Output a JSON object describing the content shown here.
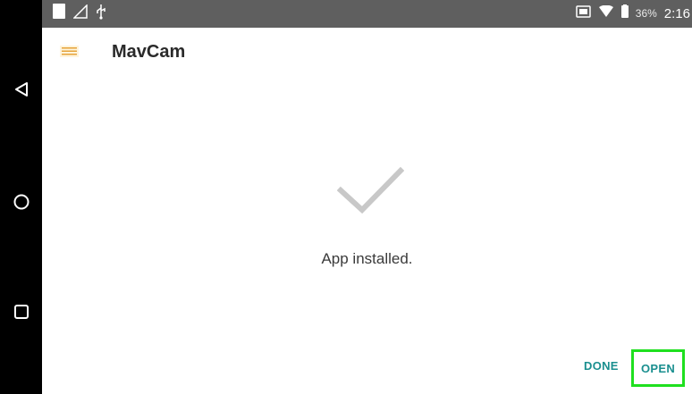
{
  "status_bar": {
    "battery_text": "36%",
    "time": "2:16"
  },
  "header": {
    "app_name": "MavCam",
    "app_icon": "mavcam-app-icon"
  },
  "main": {
    "status_icon": "checkmark-icon",
    "status_message": "App installed."
  },
  "actions": {
    "done_label": "DONE",
    "open_label": "OPEN"
  },
  "nav": {
    "items": [
      "back",
      "home",
      "recents"
    ]
  },
  "colors": {
    "accent": "#1a8f8f",
    "highlight": "#1fe01f",
    "status_bar": "#5f5f5f",
    "nav_bar": "#000000",
    "check": "#c8c8c8"
  }
}
